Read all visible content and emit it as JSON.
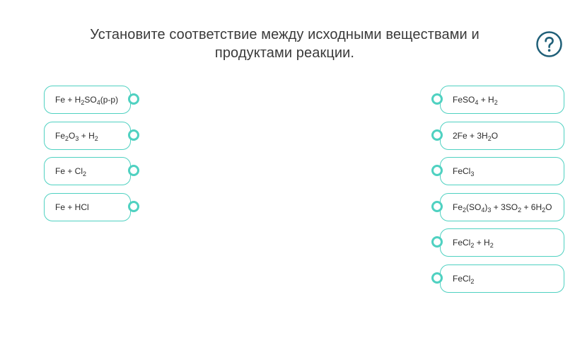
{
  "header": {
    "title_line1": "Установите соответствие между исходными веществами и",
    "title_line2": "продуктами реакции.",
    "help_icon": "question-circle-icon"
  },
  "colors": {
    "accent": "#4fd1c1",
    "help_icon": "#1f5f78",
    "text": "#3a3a3a"
  },
  "left_items": [
    {
      "parts": [
        [
          "Fe + H",
          ""
        ],
        [
          "2",
          "sub"
        ],
        [
          "SO",
          ""
        ],
        [
          "4",
          "sub"
        ],
        [
          "(р-р)",
          ""
        ]
      ]
    },
    {
      "parts": [
        [
          "Fe",
          ""
        ],
        [
          "2",
          "sub"
        ],
        [
          "O",
          ""
        ],
        [
          "3",
          "sub"
        ],
        [
          " + H",
          ""
        ],
        [
          "2",
          "sub"
        ]
      ]
    },
    {
      "parts": [
        [
          "Fe + Cl",
          ""
        ],
        [
          "2",
          "sub"
        ]
      ]
    },
    {
      "parts": [
        [
          "Fe + HCl",
          ""
        ]
      ]
    }
  ],
  "right_items": [
    {
      "parts": [
        [
          "FeSO",
          ""
        ],
        [
          "4",
          "sub"
        ],
        [
          " + H",
          ""
        ],
        [
          "2",
          "sub"
        ]
      ]
    },
    {
      "parts": [
        [
          "2Fe + 3H",
          ""
        ],
        [
          "2",
          "sub"
        ],
        [
          "O",
          ""
        ]
      ]
    },
    {
      "parts": [
        [
          "FeCl",
          ""
        ],
        [
          "3",
          "sub"
        ]
      ]
    },
    {
      "parts": [
        [
          "Fe",
          ""
        ],
        [
          "2",
          "sub"
        ],
        [
          "(SO",
          ""
        ],
        [
          "4",
          "sub"
        ],
        [
          ")",
          ""
        ],
        [
          "3",
          "sub"
        ],
        [
          " + 3SO",
          ""
        ],
        [
          "2",
          "sub"
        ],
        [
          " + 6H",
          ""
        ],
        [
          "2",
          "sub"
        ],
        [
          "O",
          ""
        ]
      ]
    },
    {
      "parts": [
        [
          "FeCl",
          ""
        ],
        [
          "2",
          "sub"
        ],
        [
          " + H",
          ""
        ],
        [
          "2",
          "sub"
        ]
      ]
    },
    {
      "parts": [
        [
          "FeCl",
          ""
        ],
        [
          "2",
          "sub"
        ]
      ]
    }
  ]
}
